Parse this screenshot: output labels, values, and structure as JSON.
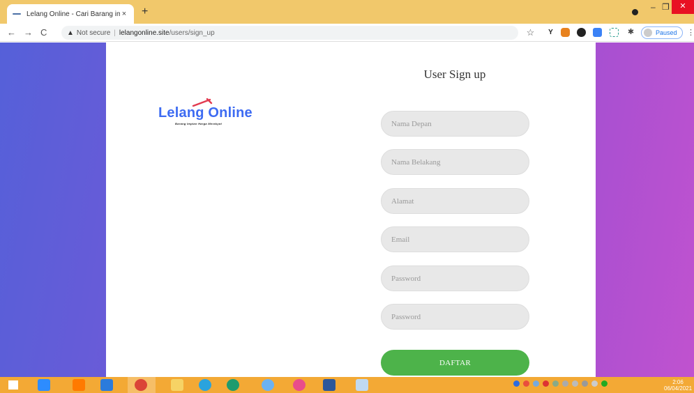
{
  "browser": {
    "tab_title": "Lelang Online - Cari Barang imp",
    "tab_close": "×",
    "new_tab": "+",
    "security_label": "Not secure",
    "url_host": "lelangonline.site",
    "url_path": "/users/sign_up",
    "profile_status": "Paused",
    "ext_y_label": "Y"
  },
  "logo": {
    "word": "Lelang Online",
    "tagline": "Barang Impian Harga Merakyat",
    "color": "#3d6bf2",
    "accent": "#e23a4f"
  },
  "form": {
    "title": "User Sign up",
    "fields": [
      {
        "placeholder": "Nama Depan",
        "type": "text",
        "name": "first-name-input"
      },
      {
        "placeholder": "Nama Belakang",
        "type": "text",
        "name": "last-name-input"
      },
      {
        "placeholder": "Alamat",
        "type": "text",
        "name": "address-input"
      },
      {
        "placeholder": "Email",
        "type": "email",
        "name": "email-input"
      },
      {
        "placeholder": "Password",
        "type": "password",
        "name": "password-input"
      },
      {
        "placeholder": "Password",
        "type": "password",
        "name": "password-confirm-input"
      }
    ],
    "submit_label": "DAFTAR",
    "submit_color": "#4db34a"
  },
  "taskbar": {
    "time": "2:06",
    "date": "06/04/2021"
  }
}
